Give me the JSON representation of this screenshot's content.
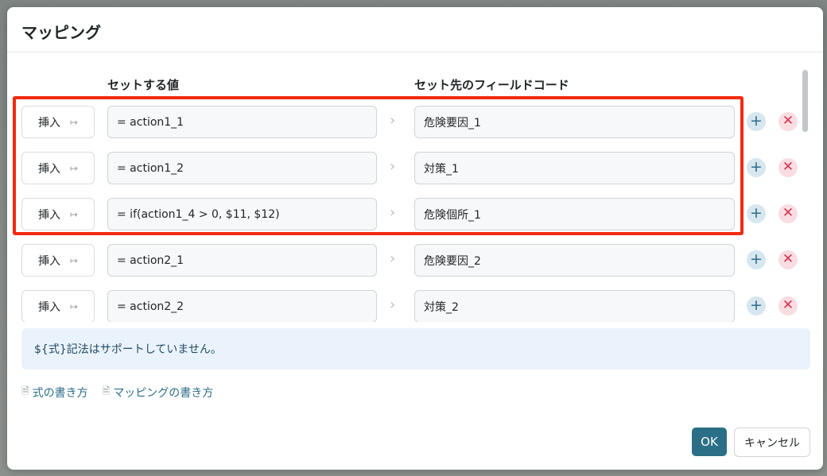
{
  "dialog": {
    "title": "マッピング"
  },
  "columns": {
    "value": "セットする値",
    "target": "セット先のフィールドコード"
  },
  "rows": [
    {
      "insert_label": "挿入",
      "value": "= action1_1",
      "target": "危険要因_1"
    },
    {
      "insert_label": "挿入",
      "value": "= action1_2",
      "target": "対策_1"
    },
    {
      "insert_label": "挿入",
      "value": "= if(action1_4 > 0, $11, $12)",
      "target": "危険個所_1"
    },
    {
      "insert_label": "挿入",
      "value": "= action2_1",
      "target": "危険要因_2"
    },
    {
      "insert_label": "挿入",
      "value": "= action2_2",
      "target": "対策_2"
    }
  ],
  "icons": {
    "insert": "insert-arrow-icon",
    "chevron": "chevron-right-icon",
    "add": "plus-icon",
    "delete": "close-icon",
    "doc": "document-icon"
  },
  "notice": "${式}記法はサポートしていません。",
  "links": {
    "formula_help": "式の書き方",
    "mapping_help": "マッピングの書き方"
  },
  "footer": {
    "ok_label": "OK",
    "cancel_label": "キャンセル"
  },
  "colors": {
    "primary": "#2a6f86",
    "highlight": "#f22a11",
    "notice_bg": "#eaf3fb",
    "add": "#2c6e8a",
    "delete": "#d6334d"
  }
}
